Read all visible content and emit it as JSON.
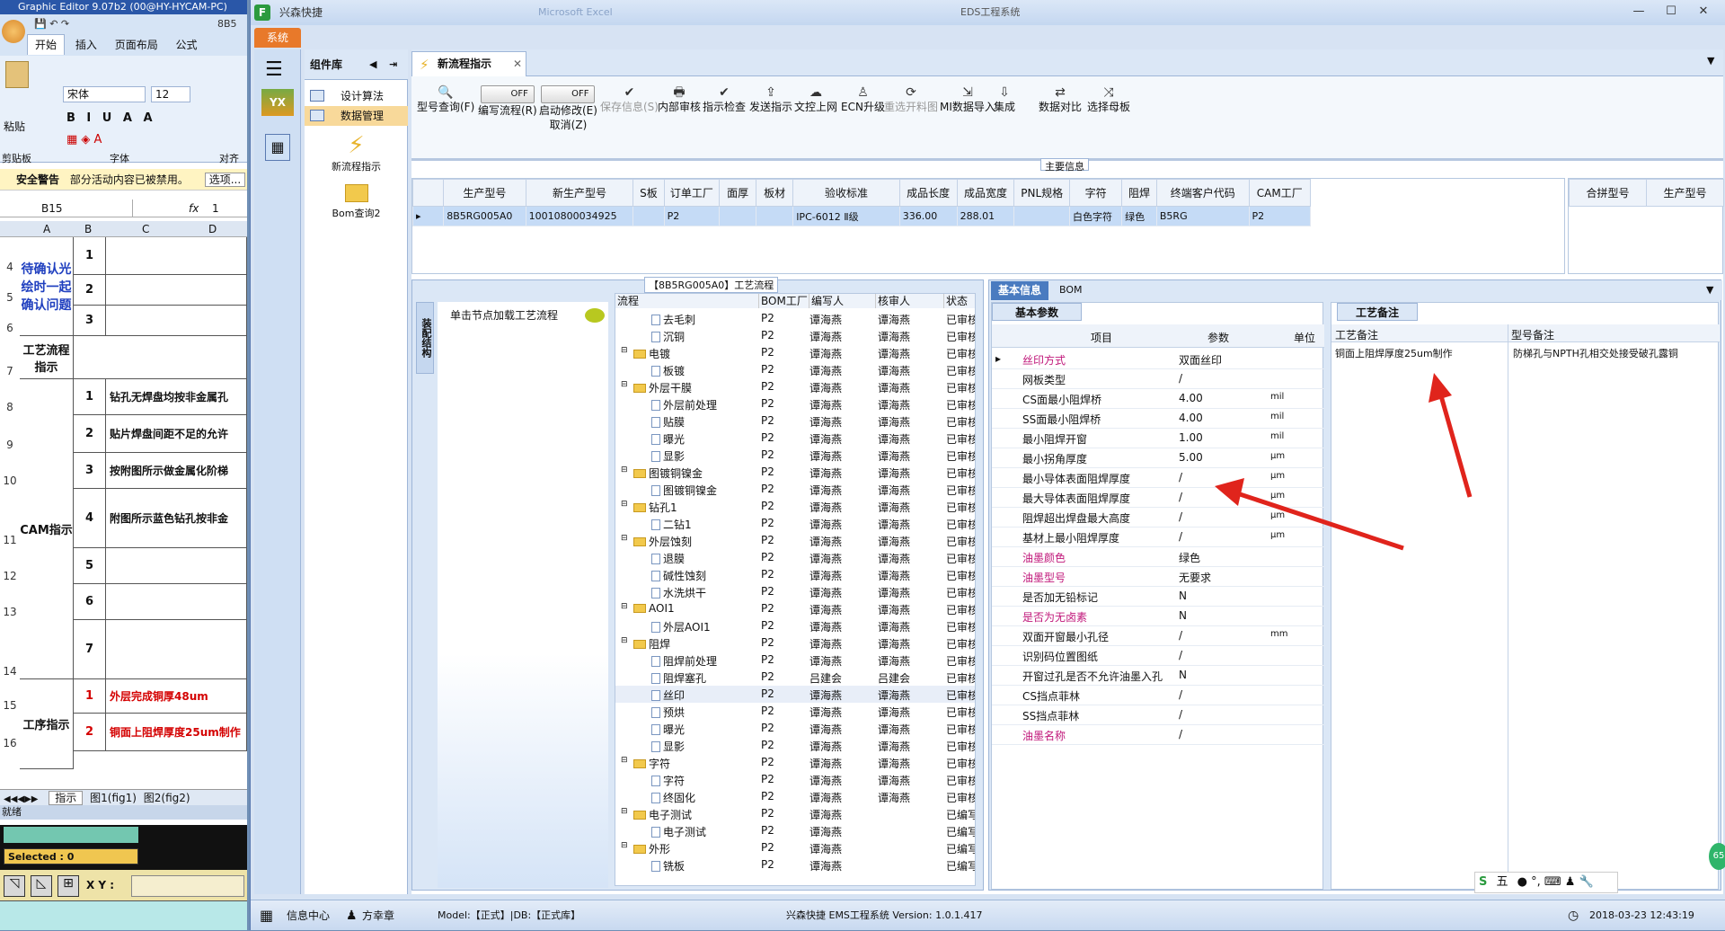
{
  "excel": {
    "title": "Graphic Editor 9.07b2 (00@HY-HYCAM-PC)",
    "tabs": [
      "开始",
      "插入",
      "页面布局",
      "公式"
    ],
    "font_name": "宋体",
    "font_size": "12",
    "groups": [
      "剪贴板",
      "字体",
      "对齐"
    ],
    "paste": "粘贴",
    "security": "安全警告",
    "security_msg": "部分活动内容已被禁用。",
    "options": "选项...",
    "cellref": "B15",
    "formula": "1",
    "cols": [
      "A",
      "B",
      "C",
      "D"
    ],
    "row_nums": [
      "4",
      "5",
      "6",
      "7",
      "8",
      "9",
      "10",
      "11",
      "12",
      "13",
      "14",
      "15",
      "16"
    ],
    "cell_confirm": "待确认光绘时一起确认问题",
    "cell_process": "工艺流程指示",
    "cell_cam": "CAM指示",
    "cell_step": "工序指示",
    "b_vals": [
      "1",
      "2",
      "3",
      "1",
      "2",
      "3",
      "4",
      "5",
      "6",
      "7",
      "1",
      "2"
    ],
    "c_vals": [
      "钻孔无焊盘均按非金属孔",
      "贴片焊盘间距不足的允许",
      "按附图所示做金属化阶梯",
      "附图所示蓝色钻孔按非金",
      "外层完成铜厚48um",
      "铜面上阻焊厚度25um制作"
    ],
    "sheets": [
      "指示",
      "图1(fig1)",
      "图2(fig2)"
    ],
    "ready": "就绪",
    "selected": "Selected : 0",
    "xy": "X Y :"
  },
  "app": {
    "title": "兴森快捷",
    "window_title": "EDS工程系统",
    "ghost": "Microsoft Excel",
    "sys_tab": "系统",
    "component_lib": "组件库",
    "comp_items": [
      "设计算法",
      "数据管理"
    ],
    "big_icons": [
      "新流程指示",
      "Bom查询2"
    ],
    "doc_tab": "新流程指示",
    "toolbar": [
      {
        "label": "型号查询(F)",
        "icon": "search-icon"
      },
      {
        "label": "编写流程(R)",
        "icon": "toggle"
      },
      {
        "label": "启动修改(E)",
        "sub": "取消(Z)",
        "icon": "toggle"
      },
      {
        "label": "保存信息(S)",
        "icon": "check-icon",
        "disabled": true
      },
      {
        "label": "内部审核",
        "icon": "print-icon"
      },
      {
        "label": "指示检查",
        "icon": "check-icon"
      },
      {
        "label": "发送指示",
        "icon": "upload-icon"
      },
      {
        "label": "文控上网",
        "icon": "cloud-icon"
      },
      {
        "label": "ECN升级",
        "icon": "person-icon"
      },
      {
        "label": "重选开料图",
        "icon": "refresh-icon",
        "disabled": true
      },
      {
        "label": "MI数据导入",
        "icon": "import-icon"
      },
      {
        "label": "集成",
        "icon": "download-icon"
      },
      {
        "label": "数据对比",
        "icon": "compare-icon"
      },
      {
        "label": "选择母板",
        "icon": "shuffle-icon"
      }
    ],
    "toggle_off": "OFF",
    "main_info": "主要信息",
    "main_headers": [
      "生产型号",
      "新生产型号",
      "S板",
      "订单工厂",
      "面厚",
      "板材",
      "验收标准",
      "成品长度",
      "成品宽度",
      "PNL规格",
      "字符",
      "阻焊",
      "终端客户代码",
      "CAM工厂"
    ],
    "main_row": [
      "8B5RG005A0",
      "10010800034925",
      "",
      "P2",
      "",
      "",
      "IPC-6012 Ⅱ级",
      "336.00",
      "288.01",
      "",
      "白色字符",
      "绿色",
      "B5RG",
      "P2"
    ],
    "side_headers": [
      "合拼型号",
      "生产型号"
    ],
    "flow_title": "【8B5RG005A0】工艺流程",
    "vtab": "装配结构",
    "click_load": "单击节点加载工艺流程",
    "flow_headers": [
      "流程",
      "BOM工厂",
      "编写人",
      "核审人",
      "状态"
    ],
    "flow_rows": [
      {
        "name": "去毛刺",
        "lvl": 2,
        "f": "P2",
        "w": "谭海燕",
        "r": "谭海燕",
        "s": "已审核"
      },
      {
        "name": "沉铜",
        "lvl": 2,
        "f": "P2",
        "w": "谭海燕",
        "r": "谭海燕",
        "s": "已审核"
      },
      {
        "name": "电镀",
        "lvl": 1,
        "f": "P2",
        "w": "谭海燕",
        "r": "谭海燕",
        "s": "已审核"
      },
      {
        "name": "板镀",
        "lvl": 2,
        "f": "P2",
        "w": "谭海燕",
        "r": "谭海燕",
        "s": "已审核"
      },
      {
        "name": "外层干膜",
        "lvl": 1,
        "f": "P2",
        "w": "谭海燕",
        "r": "谭海燕",
        "s": "已审核"
      },
      {
        "name": "外层前处理",
        "lvl": 2,
        "f": "P2",
        "w": "谭海燕",
        "r": "谭海燕",
        "s": "已审核"
      },
      {
        "name": "贴膜",
        "lvl": 2,
        "f": "P2",
        "w": "谭海燕",
        "r": "谭海燕",
        "s": "已审核"
      },
      {
        "name": "曝光",
        "lvl": 2,
        "f": "P2",
        "w": "谭海燕",
        "r": "谭海燕",
        "s": "已审核"
      },
      {
        "name": "显影",
        "lvl": 2,
        "f": "P2",
        "w": "谭海燕",
        "r": "谭海燕",
        "s": "已审核"
      },
      {
        "name": "图镀铜镍金",
        "lvl": 1,
        "f": "P2",
        "w": "谭海燕",
        "r": "谭海燕",
        "s": "已审核"
      },
      {
        "name": "图镀铜镍金",
        "lvl": 2,
        "f": "P2",
        "w": "谭海燕",
        "r": "谭海燕",
        "s": "已审核"
      },
      {
        "name": "钻孔1",
        "lvl": 1,
        "f": "P2",
        "w": "谭海燕",
        "r": "谭海燕",
        "s": "已审核"
      },
      {
        "name": "二钻1",
        "lvl": 2,
        "f": "P2",
        "w": "谭海燕",
        "r": "谭海燕",
        "s": "已审核"
      },
      {
        "name": "外层蚀刻",
        "lvl": 1,
        "f": "P2",
        "w": "谭海燕",
        "r": "谭海燕",
        "s": "已审核"
      },
      {
        "name": "退膜",
        "lvl": 2,
        "f": "P2",
        "w": "谭海燕",
        "r": "谭海燕",
        "s": "已审核"
      },
      {
        "name": "碱性蚀刻",
        "lvl": 2,
        "f": "P2",
        "w": "谭海燕",
        "r": "谭海燕",
        "s": "已审核"
      },
      {
        "name": "水洗烘干",
        "lvl": 2,
        "f": "P2",
        "w": "谭海燕",
        "r": "谭海燕",
        "s": "已审核"
      },
      {
        "name": "AOI1",
        "lvl": 1,
        "f": "P2",
        "w": "谭海燕",
        "r": "谭海燕",
        "s": "已审核"
      },
      {
        "name": "外层AOI1",
        "lvl": 2,
        "f": "P2",
        "w": "谭海燕",
        "r": "谭海燕",
        "s": "已审核"
      },
      {
        "name": "阻焊",
        "lvl": 1,
        "f": "P2",
        "w": "谭海燕",
        "r": "谭海燕",
        "s": "已审核"
      },
      {
        "name": "阻焊前处理",
        "lvl": 2,
        "f": "P2",
        "w": "谭海燕",
        "r": "谭海燕",
        "s": "已审核"
      },
      {
        "name": "阻焊塞孔",
        "lvl": 2,
        "f": "P2",
        "w": "吕建会",
        "r": "吕建会",
        "s": "已审核"
      },
      {
        "name": "丝印",
        "lvl": 2,
        "f": "P2",
        "w": "谭海燕",
        "r": "谭海燕",
        "s": "已审核"
      },
      {
        "name": "预烘",
        "lvl": 2,
        "f": "P2",
        "w": "谭海燕",
        "r": "谭海燕",
        "s": "已审核"
      },
      {
        "name": "曝光",
        "lvl": 2,
        "f": "P2",
        "w": "谭海燕",
        "r": "谭海燕",
        "s": "已审核"
      },
      {
        "name": "显影",
        "lvl": 2,
        "f": "P2",
        "w": "谭海燕",
        "r": "谭海燕",
        "s": "已审核"
      },
      {
        "name": "字符",
        "lvl": 1,
        "f": "P2",
        "w": "谭海燕",
        "r": "谭海燕",
        "s": "已审核"
      },
      {
        "name": "字符",
        "lvl": 2,
        "f": "P2",
        "w": "谭海燕",
        "r": "谭海燕",
        "s": "已审核"
      },
      {
        "name": "终固化",
        "lvl": 2,
        "f": "P2",
        "w": "谭海燕",
        "r": "谭海燕",
        "s": "已审核"
      },
      {
        "name": "电子测试",
        "lvl": 1,
        "f": "P2",
        "w": "谭海燕",
        "r": "",
        "s": "已编写"
      },
      {
        "name": "电子测试",
        "lvl": 2,
        "f": "P2",
        "w": "谭海燕",
        "r": "",
        "s": "已编写"
      },
      {
        "name": "外形",
        "lvl": 1,
        "f": "P2",
        "w": "谭海燕",
        "r": "",
        "s": "已编写"
      },
      {
        "name": "铣板",
        "lvl": 2,
        "f": "P2",
        "w": "谭海燕",
        "r": "",
        "s": "已编写"
      }
    ],
    "info_tabs": [
      "基本信息",
      "BOM"
    ],
    "basic_tab": "基本参数",
    "param_headers": [
      "项目",
      "参数",
      "单位"
    ],
    "params": [
      {
        "k": "丝印方式",
        "v": "双面丝印",
        "u": "",
        "pink": true
      },
      {
        "k": "网板类型",
        "v": "/",
        "u": ""
      },
      {
        "k": "CS面最小阻焊桥",
        "v": "4.00",
        "u": "mil"
      },
      {
        "k": "SS面最小阻焊桥",
        "v": "4.00",
        "u": "mil"
      },
      {
        "k": "最小阻焊开窗",
        "v": "1.00",
        "u": "mil"
      },
      {
        "k": "最小拐角厚度",
        "v": "5.00",
        "u": "μm"
      },
      {
        "k": "最小导体表面阻焊厚度",
        "v": "/",
        "u": "μm"
      },
      {
        "k": "最大导体表面阻焊厚度",
        "v": "/",
        "u": "μm"
      },
      {
        "k": "阻焊超出焊盘最大高度",
        "v": "/",
        "u": "μm"
      },
      {
        "k": "基材上最小阻焊厚度",
        "v": "/",
        "u": "μm"
      },
      {
        "k": "油墨颜色",
        "v": "绿色",
        "u": "",
        "pink": true
      },
      {
        "k": "油墨型号",
        "v": "无要求",
        "u": "",
        "pink": true
      },
      {
        "k": "是否加无铅标记",
        "v": "N",
        "u": ""
      },
      {
        "k": "是否为无卤素",
        "v": "N",
        "u": "",
        "pink": true
      },
      {
        "k": "双面开窗最小孔径",
        "v": "/",
        "u": "mm"
      },
      {
        "k": "识别码位置图纸",
        "v": "/",
        "u": ""
      },
      {
        "k": "开窗过孔是否不允许油墨入孔",
        "v": "N",
        "u": ""
      },
      {
        "k": "CS挡点菲林",
        "v": "/",
        "u": ""
      },
      {
        "k": "SS挡点菲林",
        "v": "/",
        "u": ""
      },
      {
        "k": "油墨名称",
        "v": "/",
        "u": "",
        "pink": true
      }
    ],
    "remark_tab": "工艺备注",
    "remark_headers": [
      "工艺备注",
      "型号备注"
    ],
    "remark_values": [
      "铜面上阻焊厚度25um制作",
      "防梯孔与NPTH孔相交处接受破孔露铜"
    ],
    "status": {
      "info_center": "信息中心",
      "user": "方幸章",
      "model": "Model:【正式】|DB:【正式库】",
      "version": "兴森快捷 EMS工程系统 Version: 1.0.1.417",
      "datetime": "2018-03-23 12:43:19"
    },
    "ime": "五",
    "green_badge": "65"
  },
  "colors": {
    "accent": "#4a7bc0",
    "orange": "#e8792a",
    "arrow": "#e0241c",
    "pink": "#c0177a"
  }
}
